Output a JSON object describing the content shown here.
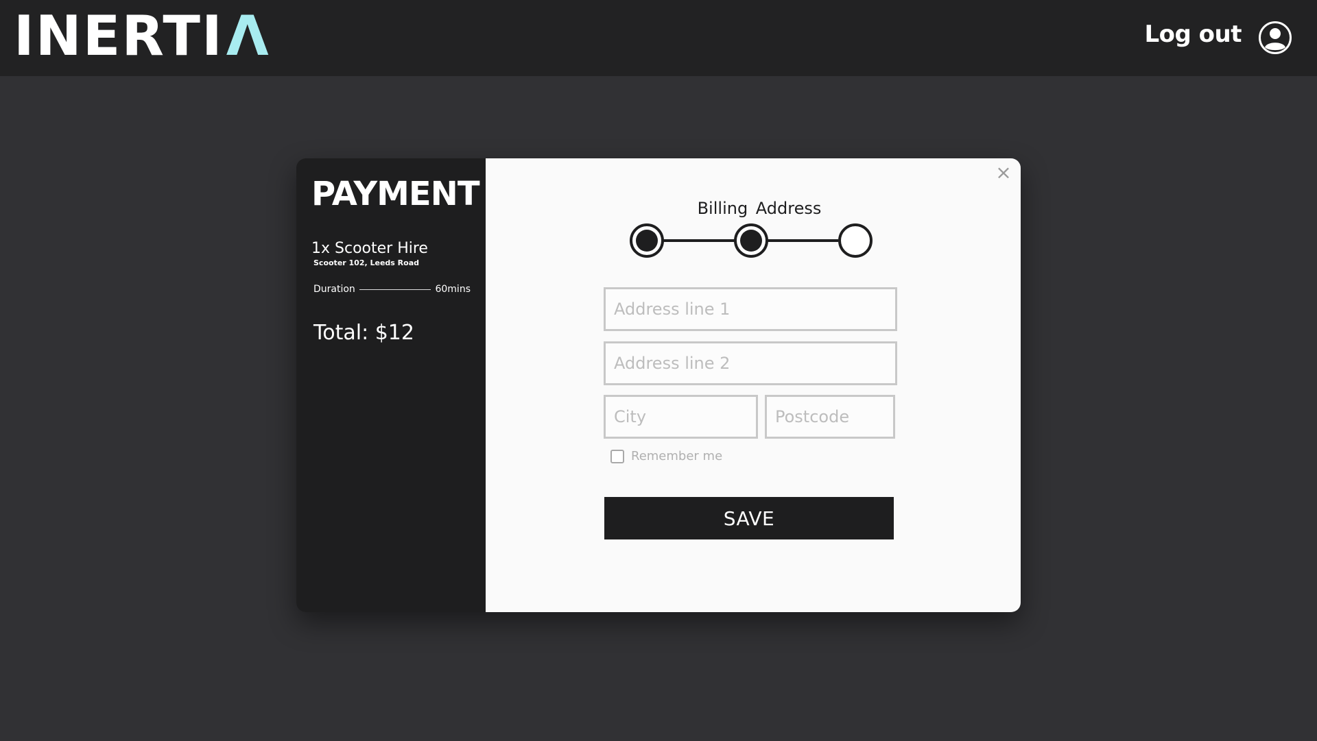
{
  "header": {
    "brand_prefix": "INERTI",
    "brand_mark": "Λ",
    "brand_mark_color": "#a8ecf0",
    "logout_label": "Log out",
    "avatar_icon": "user-circle-icon"
  },
  "summary": {
    "title": "PAYMENT",
    "item_name": "1x Scooter Hire",
    "item_location": "Scooter 102, Leeds Road",
    "duration_label": "Duration",
    "duration_value": "60mins",
    "total": "Total: $12"
  },
  "form": {
    "close_icon": "close-icon",
    "close_glyph": "×",
    "step_title": "Billing  Address",
    "steps": [
      {
        "state": "done"
      },
      {
        "state": "done"
      },
      {
        "state": "pending"
      }
    ],
    "address_line1": {
      "placeholder": "Address line 1",
      "value": ""
    },
    "address_line2": {
      "placeholder": "Address line 2",
      "value": ""
    },
    "city": {
      "placeholder": "City",
      "value": ""
    },
    "postcode": {
      "placeholder": "Postcode",
      "value": ""
    },
    "remember_label": "Remember me",
    "remember_checked": false,
    "save_label": "SAVE"
  },
  "colors": {
    "background": "#313134",
    "header_bg": "#222223",
    "summary_bg": "#1e1e1f",
    "panel_bg": "#fafafa",
    "accent": "#a8ecf0"
  }
}
